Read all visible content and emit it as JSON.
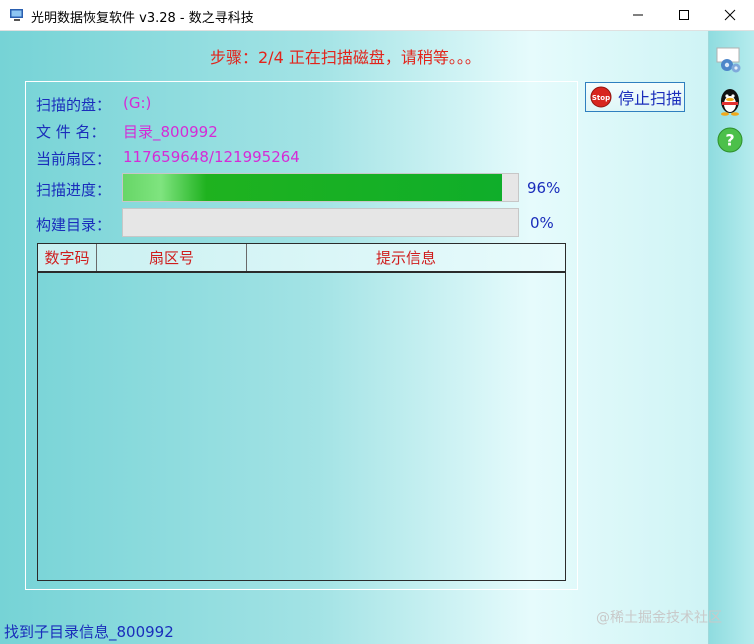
{
  "window": {
    "title": "光明数据恢复软件 v3.28 - 数之寻科技"
  },
  "step": {
    "text": "步骤：2/4 正在扫描磁盘，请稍等。。。"
  },
  "scan": {
    "disk_label": "扫描的盘：",
    "disk_value": "(G:)",
    "file_label": "文 件 名：",
    "file_value": "目录_800992",
    "sector_label": "当前扇区：",
    "sector_value": "117659648/121995264",
    "progress_label": "扫描进度：",
    "progress_percent_text": "96%",
    "progress_value": 0.96,
    "build_label": "构建目录：",
    "build_percent_text": "0%",
    "build_value": 0
  },
  "list": {
    "columns": [
      "数字码",
      "扇区号",
      "提示信息"
    ],
    "rows": []
  },
  "buttons": {
    "stop_label": "停止扫描",
    "stop_icon_text": "Stop"
  },
  "status": {
    "text": "找到子目录信息_800992"
  },
  "watermark": {
    "text": "@稀土掘金技术社区"
  },
  "icons": [
    "app-icon",
    "minimize-icon",
    "maximize-icon",
    "close-icon",
    "stop-icon",
    "settings-gears-icon",
    "qq-penguin-icon",
    "help-icon"
  ],
  "colors": {
    "label_blue": "#1a2dbb",
    "value_magenta": "#d52bd6",
    "step_red": "#e2231a",
    "progress_green": "#0fae2a",
    "header_red": "#cf1d1d"
  }
}
